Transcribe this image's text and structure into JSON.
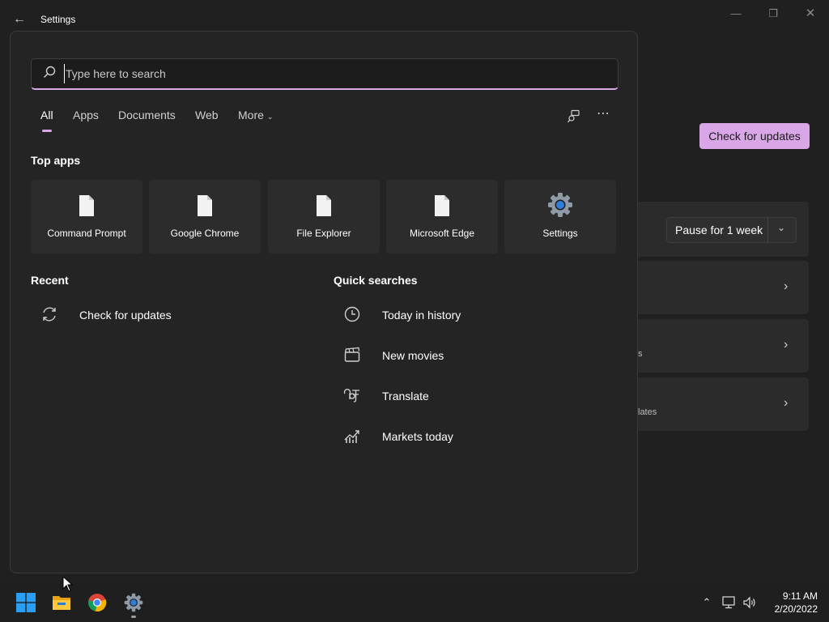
{
  "window": {
    "title": "Settings",
    "back_icon": "arrow-left-icon",
    "minimize_icon": "minimize-icon",
    "maximize_icon": "restore-icon",
    "close_icon": "close-icon"
  },
  "background": {
    "check_updates_label": "Check for updates",
    "pause_label": "Pause for 1 week",
    "card3_fragment": "s",
    "card4_fragment": "lates"
  },
  "search": {
    "placeholder": "Type here to search",
    "tabs": [
      {
        "label": "All"
      },
      {
        "label": "Apps"
      },
      {
        "label": "Documents"
      },
      {
        "label": "Web"
      },
      {
        "label": "More"
      }
    ],
    "top_apps_title": "Top apps",
    "top_apps": [
      {
        "label": "Command Prompt",
        "icon": "document-icon"
      },
      {
        "label": "Google Chrome",
        "icon": "document-icon"
      },
      {
        "label": "File Explorer",
        "icon": "document-icon"
      },
      {
        "label": "Microsoft Edge",
        "icon": "document-icon"
      },
      {
        "label": "Settings",
        "icon": "gear-icon"
      }
    ],
    "recent_title": "Recent",
    "recent": [
      {
        "label": "Check for updates",
        "icon": "sync-icon"
      }
    ],
    "quick_title": "Quick searches",
    "quick": [
      {
        "label": "Today in history",
        "icon": "clock-icon"
      },
      {
        "label": "New movies",
        "icon": "clapperboard-icon"
      },
      {
        "label": "Translate",
        "icon": "translate-icon"
      },
      {
        "label": "Markets today",
        "icon": "chart-icon"
      }
    ]
  },
  "taskbar": {
    "time": "9:11 AM",
    "date": "2/20/2022"
  },
  "colors": {
    "accent": "#d9a6e8",
    "background": "#202020",
    "flyout": "#242424"
  }
}
